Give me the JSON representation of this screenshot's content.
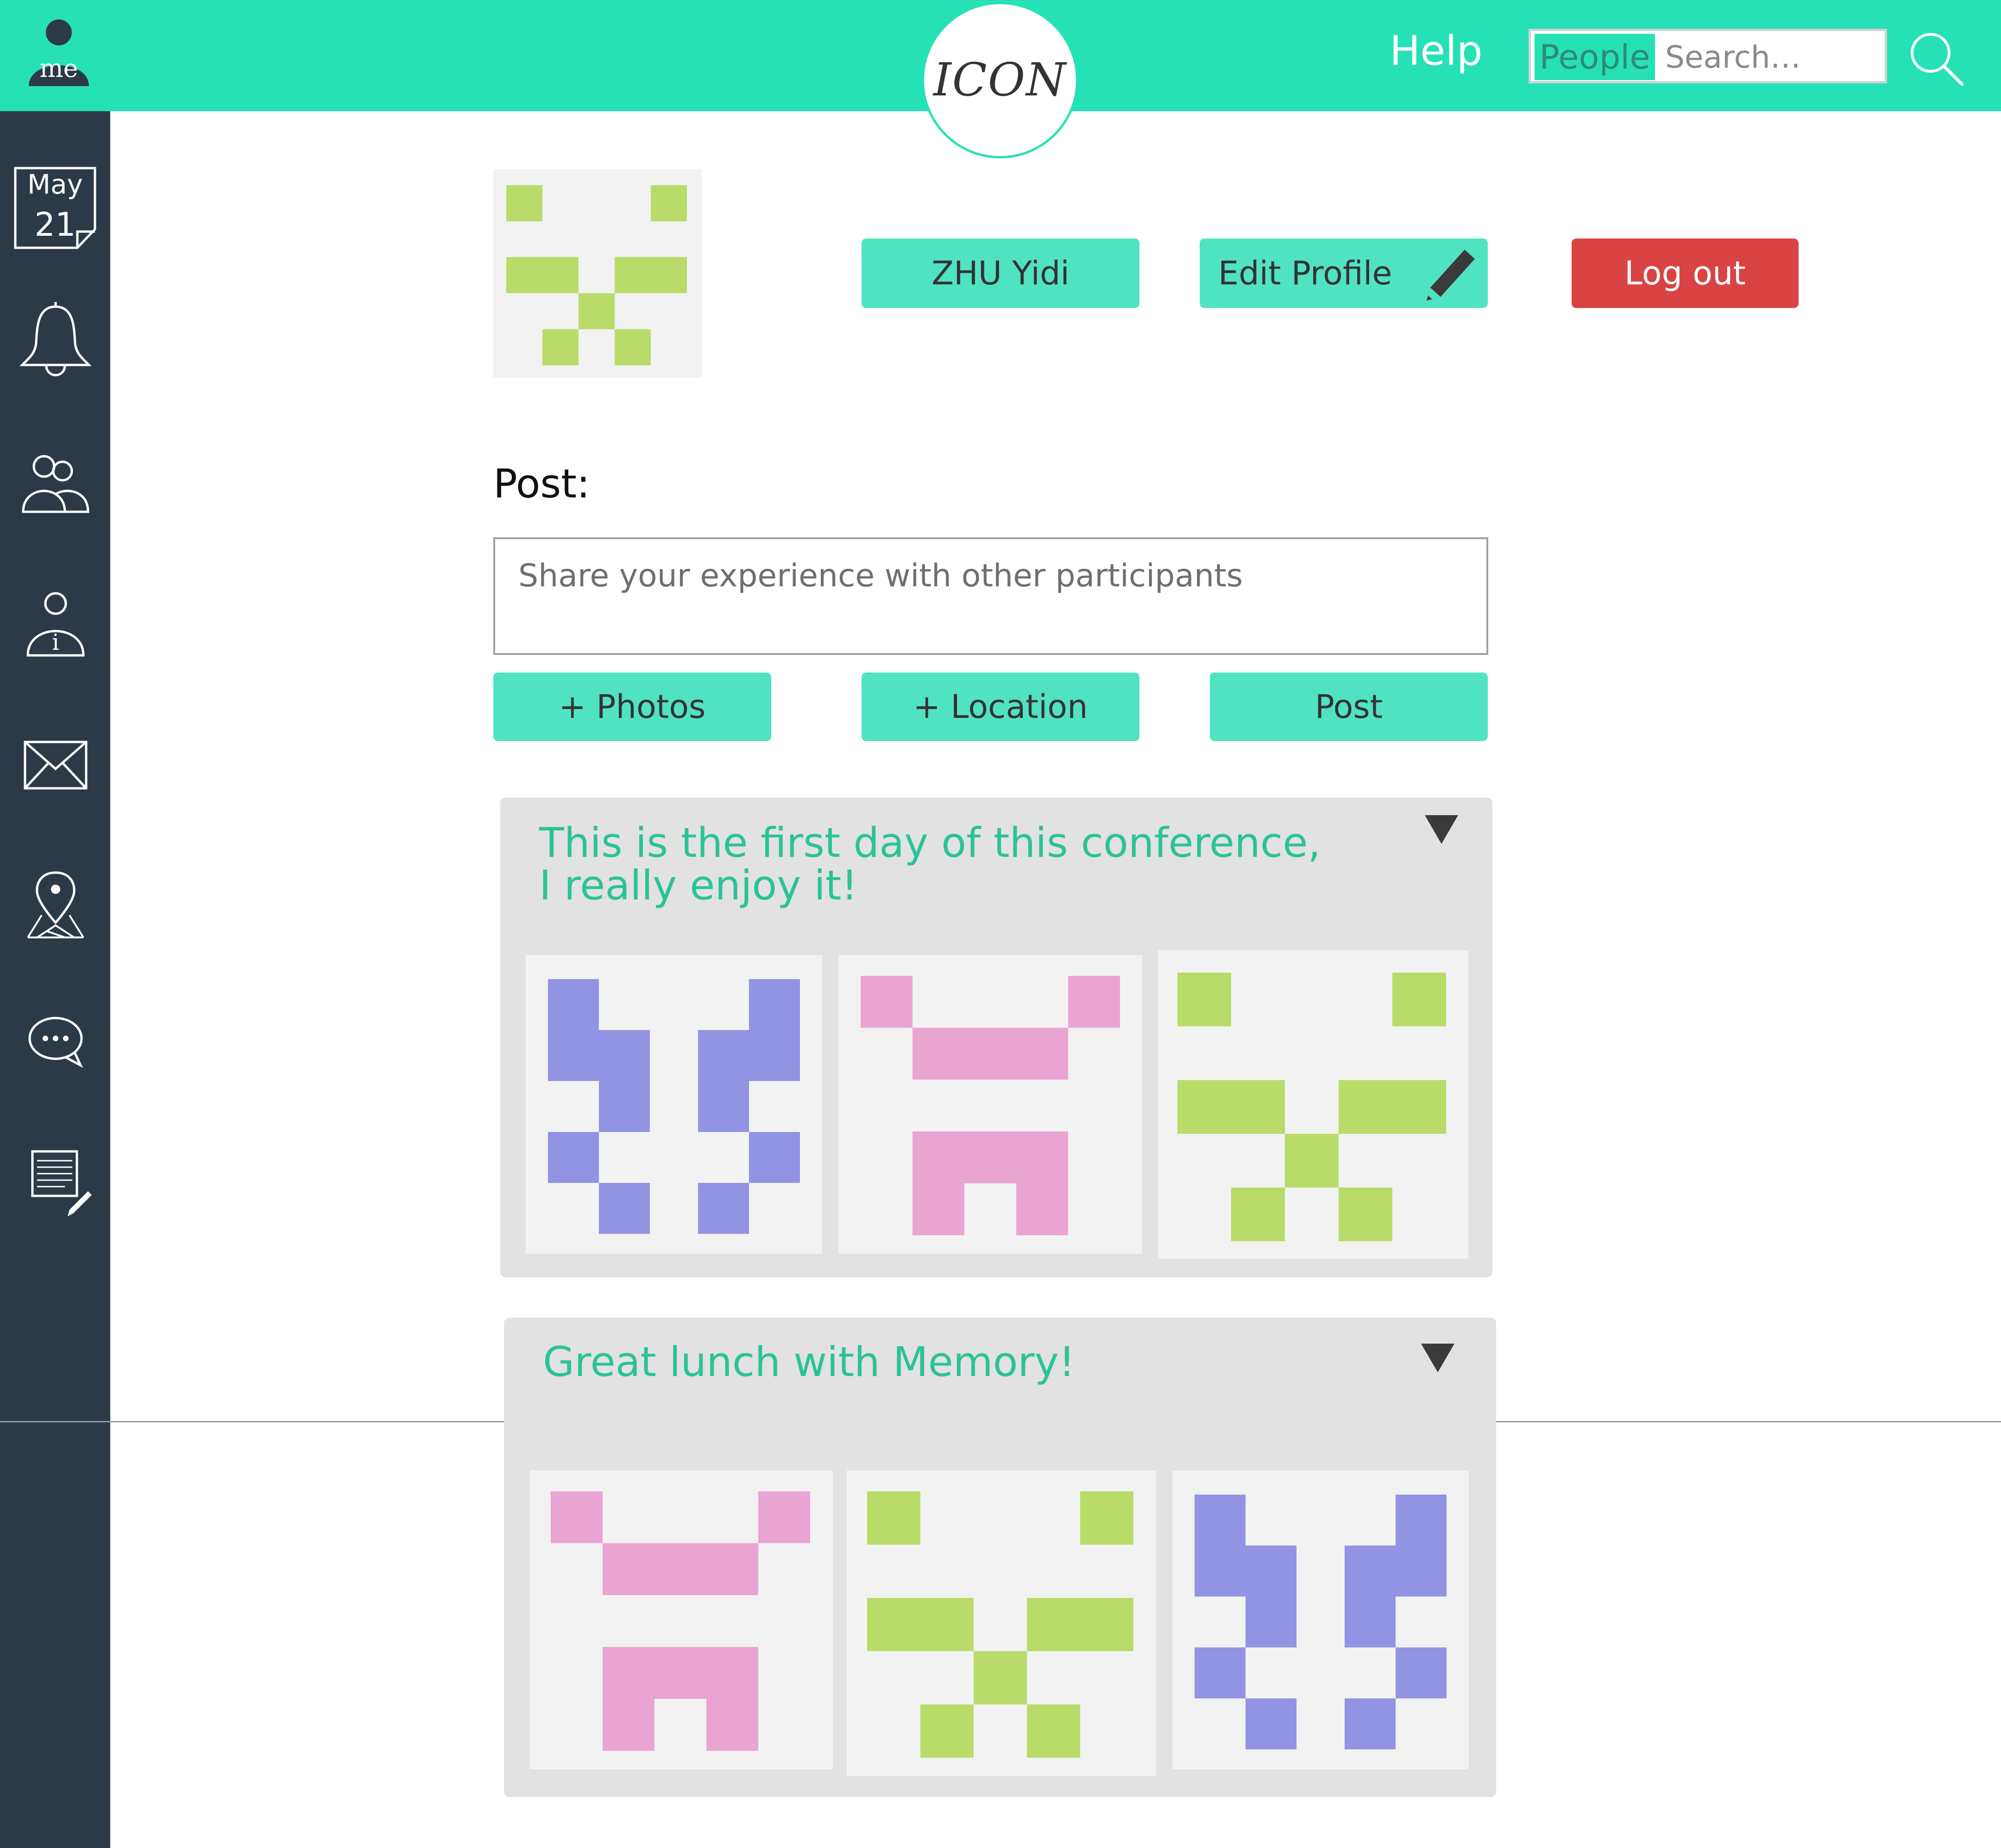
{
  "header": {
    "me_label": "me",
    "logo_text": "ICON",
    "help_label": "Help",
    "search": {
      "scope_label": "People",
      "placeholder": "Search…"
    }
  },
  "sidebar": {
    "calendar": {
      "month": "May",
      "day": "21"
    },
    "items": [
      "bell-icon",
      "people-icon",
      "info-person-icon",
      "mail-icon",
      "map-pin-icon",
      "chat-icon",
      "notes-edit-icon"
    ]
  },
  "profile": {
    "name_label": "ZHU Yidi",
    "edit_label": "Edit Profile",
    "logout_label": "Log out"
  },
  "composer": {
    "label": "Post:",
    "placeholder": "Share your experience with other participants",
    "photos_label": "+ Photos",
    "location_label": "+ Location",
    "post_label": "Post"
  },
  "posts": [
    {
      "text": "This is the first day of this conference, I really enjoy it!"
    },
    {
      "text": "Great lunch with Memory!"
    }
  ],
  "colors": {
    "header_bg": "#26e1b6",
    "sidebar_bg": "#2c3a47",
    "button_bg": "#50e3c2",
    "logout_bg": "#d94343",
    "post_text": "#2ac397",
    "identicon_green": "#b9db6a",
    "identicon_pink": "#eaa4d2",
    "identicon_violet": "#9393e3"
  }
}
